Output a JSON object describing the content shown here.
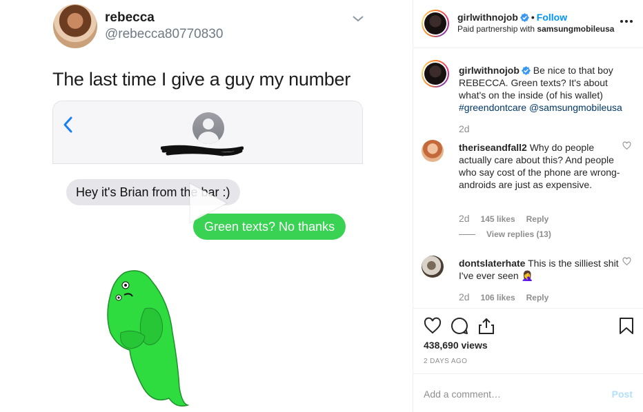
{
  "media": {
    "tweet": {
      "name": "rebecca",
      "handle": "@rebecca80770830",
      "text": "The last time I give a guy my number"
    },
    "imessage": {
      "incoming": "Hey it's Brian from the bar :)",
      "outgoing": "Green texts? No thanks"
    },
    "icons": [
      "chevron-down-icon",
      "back-chevron-icon",
      "contact-avatar-icon",
      "play-icon"
    ]
  },
  "header": {
    "username": "girlwithnojob",
    "follow_label": "Follow",
    "separator": "•",
    "sub_prefix": "Paid partnership with ",
    "partner": "samsungmobileusa"
  },
  "caption": {
    "username": "girlwithnojob",
    "text": " Be nice to that boy REBECCA. Green texts? It's about what's on the inside (of his wallet) ",
    "hashtag": "#greendontcare",
    "mention": "@samsungmobileusa",
    "age": "2d"
  },
  "comments": [
    {
      "username": "theriseandfall2",
      "text": " Why do people actually care about this? And people who say cost of the phone are wrong-androids are just as expensive.",
      "age": "2d",
      "likes": "145 likes",
      "reply_label": "Reply",
      "view_replies": "View replies (13)"
    },
    {
      "username": "dontslaterhate",
      "text": " This is the silliest shit I've ever seen 🤦‍♀️",
      "age": "2d",
      "likes": "106 likes",
      "reply_label": "Reply"
    }
  ],
  "stats": {
    "views": "438,690 views",
    "date": "2 DAYS AGO"
  },
  "add_comment": {
    "placeholder": "Add a comment…",
    "post_label": "Post"
  },
  "colors": {
    "link_blue": "#0095f6",
    "hashtag_blue": "#00376b",
    "imessage_green": "#39d253",
    "muted": "#8e8e8e"
  }
}
